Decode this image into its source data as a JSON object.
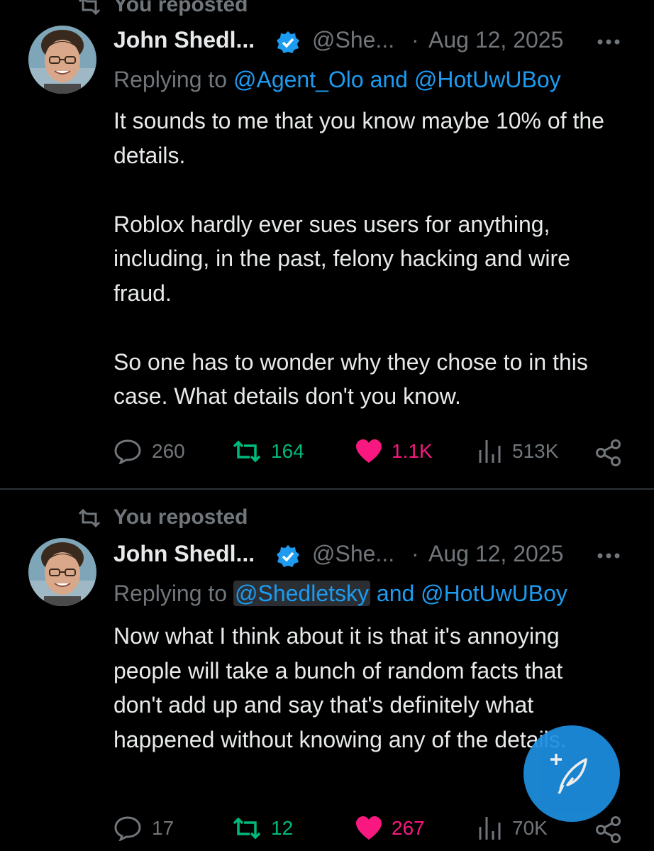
{
  "colors": {
    "background": "#000000",
    "text": "#e7e9ea",
    "muted": "#71767b",
    "accent": "#1d9bf0",
    "repost_green": "#00ba7c",
    "like_pink": "#f91880"
  },
  "tweets": [
    {
      "repost_label": "You reposted",
      "author_name": "John Shedl...",
      "handle": "@She...",
      "separator": "·",
      "date": "Aug 12, 2025",
      "replying_prefix": "Replying to ",
      "replying_mention_1": "@Agent_Olo",
      "replying_and": " and ",
      "replying_mention_2": "@HotUwUBoy",
      "body": [
        "It sounds to me that you know maybe 10% of the details.",
        "Roblox hardly ever sues users for anything, including, in the past, felony hacking and wire fraud.",
        "So one has to wonder why they chose to in this case. What details don't you know."
      ],
      "replies": "260",
      "reposts": "164",
      "likes": "1.1K",
      "views": "513K",
      "reposted": true,
      "liked": true
    },
    {
      "repost_label": "You reposted",
      "author_name": "John Shedl...",
      "handle": "@She...",
      "separator": "·",
      "date": "Aug 12, 2025",
      "replying_prefix": "Replying to ",
      "replying_mention_1": "@Shedletsky",
      "replying_and": " and ",
      "replying_mention_2": "@HotUwUBoy",
      "body": [
        "Now what I think about it is that it's annoying people will take a bunch of random facts that don't add up and say that's definitely what happened without knowing any of the details."
      ],
      "replies": "17",
      "reposts": "12",
      "likes": "267",
      "views": "70K",
      "reposted": true,
      "liked": true
    }
  ],
  "compose_button": {
    "icon": "compose-feather-icon"
  }
}
